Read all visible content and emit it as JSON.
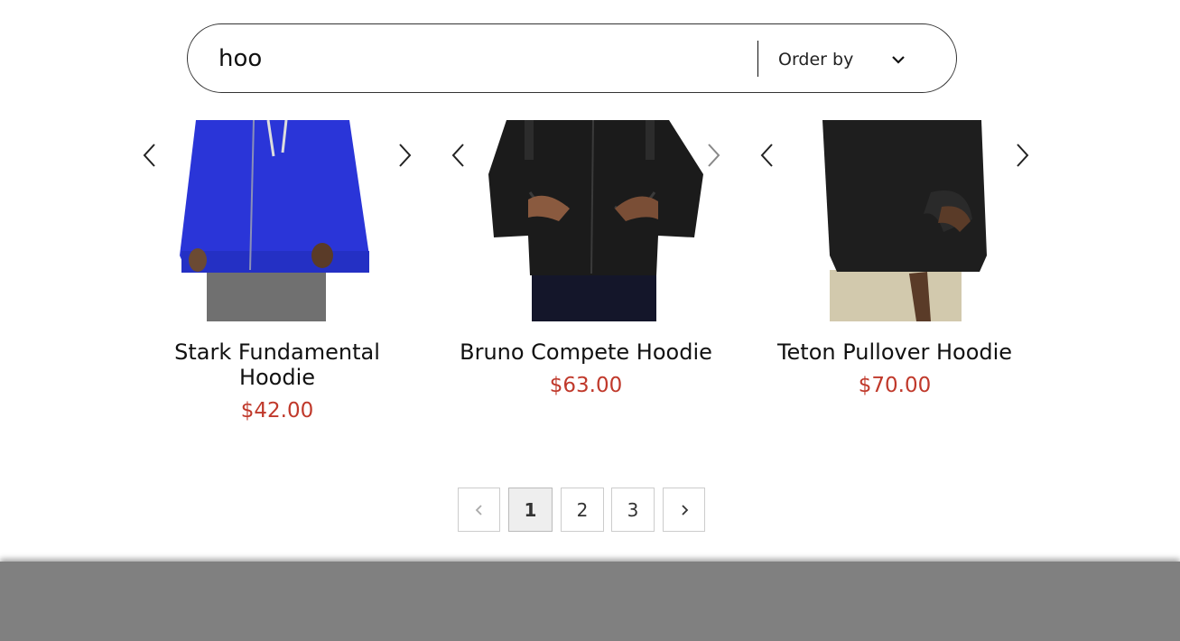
{
  "search": {
    "value": "hoo",
    "order_label": "Order by"
  },
  "products": [
    {
      "name": "Stark Fundamental Hoodie",
      "price": "$42.00",
      "color": "#2a35d8"
    },
    {
      "name": "Bruno Compete Hoodie",
      "price": "$63.00",
      "color": "#1b1b1b"
    },
    {
      "name": "Teton Pullover Hoodie",
      "price": "$70.00",
      "color": "#1e1e1e"
    }
  ],
  "pagination": {
    "pages": [
      "1",
      "2",
      "3"
    ],
    "current": "1"
  },
  "colors": {
    "price": "#c0392b",
    "footer": "#808080"
  }
}
